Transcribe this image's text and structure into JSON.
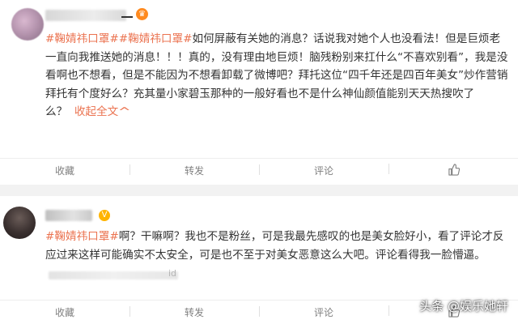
{
  "colors": {
    "tag": "#eb7350",
    "text": "#333333",
    "toolbar_text": "#808080",
    "badge_orange": "#ff8a1f",
    "badge_gold": "#ffb400"
  },
  "posts": [
    {
      "username_visible_suffix": "",
      "badge_icon": "orange-v-badge-icon",
      "content": {
        "tags": [
          "#鞠婧祎口罩#",
          "#鞠婧祎口罩#"
        ],
        "text": "如何屏蔽有关她的消息？话说我对她个人也没看法！但是巨烦老一直向我推送她的消息！！！真的，没有理由地巨烦！脑残粉别来扛什么“不喜欢别看”，我是没看啊也不想看，但是不能因为不想看卸载了微博吧？拜托这位“四千年还是四百年美女”炒作营销拜托有个度好么？充其量小家碧玉那种的一般好看也不是什么神仙颜值能别天天热搜吹了么？",
        "more": "收起全文",
        "more_arrow": "^"
      },
      "toolbar": {
        "favorite": "收藏",
        "repost": "转发",
        "comment": "评论",
        "like_icon": "thumbs-up-icon"
      }
    },
    {
      "badge_icon": "gold-v-badge-icon",
      "content": {
        "tags": [
          "#鞠婧祎口罩#"
        ],
        "text": "啊？干嘛啊？我也不是粉丝，可是我最先感叹的也是美女脸好小，看了评论才反应过来这样可能确实不太安全，可是也不至于对美女恶意这么大吧。评论看得我一脸懵逼。"
      },
      "meta_suffix": "id",
      "toolbar": {
        "favorite": "收藏",
        "repost": "转发",
        "comment": "评论",
        "like_icon": "thumbs-up-icon"
      }
    }
  ],
  "watermark": "头条 @娱乐她轩"
}
